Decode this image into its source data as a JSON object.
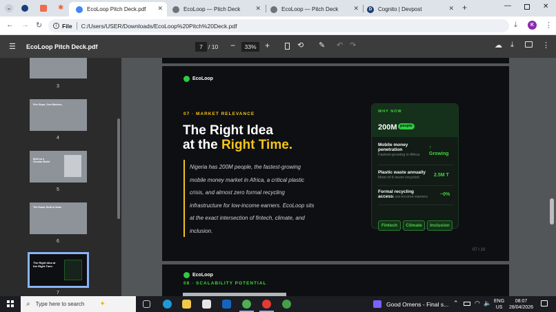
{
  "tabs": [
    {
      "title": "EcoLoop Pitch Deck.pdf"
    },
    {
      "title": "EcoLoop — Pitch Deck"
    },
    {
      "title": "EcoLoop — Pitch Deck"
    },
    {
      "title": "Cognito | Devpost"
    }
  ],
  "address": {
    "label": "File",
    "url": "C:/Users/USER/Downloads/EcoLoop%20Pitch%20Deck.pdf"
  },
  "pdf": {
    "filename": "EcoLoop Pitch Deck.pdf",
    "page_current": "7",
    "page_total": "/ 10",
    "zoom": "33%"
  },
  "thumbnails": [
    {
      "num": "3",
      "caption": ""
    },
    {
      "num": "4",
      "caption": "Five Steps. Zero Barriers."
    },
    {
      "num": "5",
      "caption": "Built on a Circular Model"
    },
    {
      "num": "6",
      "caption": "The Room, Built to Scale"
    },
    {
      "num": "7",
      "caption": "The Right Idea at the Right Time."
    }
  ],
  "slide": {
    "brand": "EcoLoop",
    "section": "07 · MARKET RELEVANCE",
    "headline_line1": "The Right Idea",
    "headline_line2_prefix": "at the ",
    "headline_line2_accent": "Right Time.",
    "body": "Nigeria has 200M people, the fastest-growing mobile money market in Africa, a critical plastic crisis, and almost zero formal recycling infrastructure for low-income earners. EcoLoop sits at the exact intersection of fintech, climate, and inclusion.",
    "page_label": "07 / 10",
    "card": {
      "title": "WHY NOW",
      "big_value": "200M",
      "badge": "people",
      "rows": [
        {
          "label": "Mobile money penetration",
          "sub": "Fastest-growing in Africa",
          "value": "Growing",
          "arrow": "↑"
        },
        {
          "label": "Plastic waste annually",
          "sub": "Most of it never recycled",
          "value": "2.5M T"
        },
        {
          "label": "Formal recycling access",
          "sub": "Low-income earners",
          "value": "~0%"
        }
      ],
      "chips": [
        "Fintech",
        "Climate",
        "Inclusion"
      ]
    }
  },
  "next_slide": {
    "brand": "EcoLoop",
    "section": "08 · SCALABILITY POTENTIAL"
  },
  "taskbar": {
    "search_placeholder": "Type here to search",
    "media_title": "Good Omens - Final s...",
    "lang": "ENG",
    "region": "US",
    "time": "08:07",
    "date": "28/04/2026"
  },
  "colors": {
    "accent_yellow": "#f5c518",
    "accent_green": "#3ddc3a",
    "slide_bg": "#0d0f12",
    "toolbar_dark": "#3c3c3c"
  }
}
